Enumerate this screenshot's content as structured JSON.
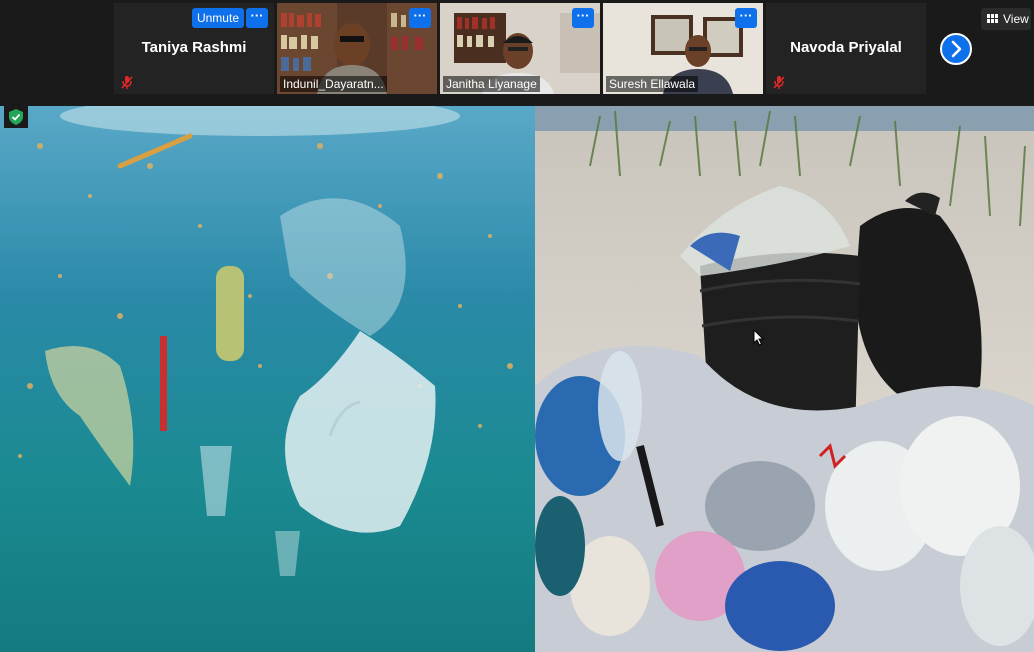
{
  "participants": [
    {
      "name": "Taniya Rashmi",
      "video": false,
      "muted": true,
      "unmute_label": "Unmute",
      "more_label": "···"
    },
    {
      "name": "Indunil_Dayaratn...",
      "video": true,
      "more_label": "···"
    },
    {
      "name": "Janitha Liyanage",
      "video": true,
      "active_speaker": true,
      "more_label": "···"
    },
    {
      "name": "Suresh Ellawala",
      "video": true,
      "more_label": "···"
    },
    {
      "name": "Navoda Priyalal",
      "video": false,
      "muted": true
    }
  ],
  "controls": {
    "view_label": "View"
  },
  "colors": {
    "accent": "#0e71eb",
    "active_border": "#8bc34a",
    "muted_red": "#e02828",
    "security_green": "#23a55a"
  },
  "icons": [
    "microphone-muted-icon",
    "chevron-right-icon",
    "gallery-view-icon",
    "security-shield-icon",
    "more-options-icon",
    "mouse-pointer-icon"
  ]
}
